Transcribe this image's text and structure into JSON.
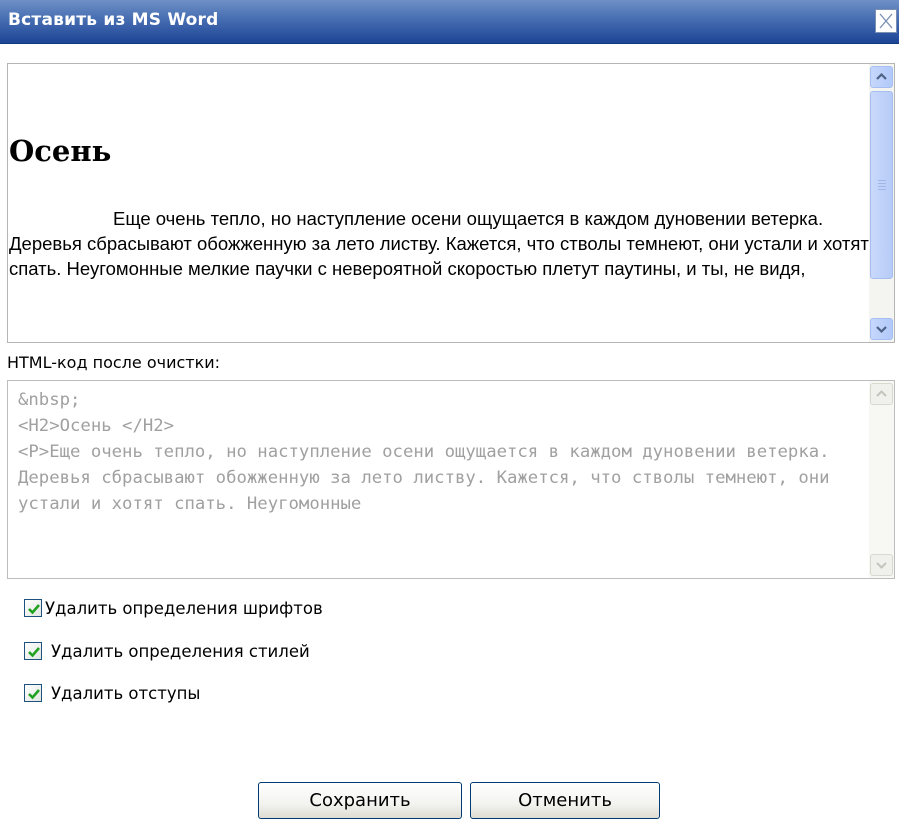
{
  "dialog": {
    "title": "Вставить из MS Word",
    "close_icon": "close-icon"
  },
  "preview": {
    "heading": "Осень",
    "paragraph": "Еще очень тепло, но наступление осени ощущается в каждом дуновении ветерка. Деревья сбрасывают обожженную за лето листву. Кажется, что стволы темнеют, они устали и хотят спать. Неугомонные мелкие паучки с невероятной скоростью плетут паутины, и ты, не видя,"
  },
  "cleaned": {
    "label": "HTML-код после очистки:",
    "code": "&nbsp;\n<H2>Осень </H2>\n<P>Еще очень тепло, но наступление осени ощущается в каждом дуновении ветерка. Деревья сбрасывают обожженную за лето листву. Кажется, что стволы темнеют, они устали и хотят спать. Неугомонные"
  },
  "options": [
    {
      "label": "Удалить определения шрифтов",
      "checked": true
    },
    {
      "label": "Удалить определения стилей",
      "checked": true
    },
    {
      "label": "Удалить отступы",
      "checked": true
    }
  ],
  "buttons": {
    "save": "Сохранить",
    "cancel": "Отменить"
  },
  "colors": {
    "titlebar_top": "#6f90c6",
    "titlebar_bottom": "#1d4495",
    "checkmark": "#21a121",
    "code_text": "#a0a0a0"
  }
}
